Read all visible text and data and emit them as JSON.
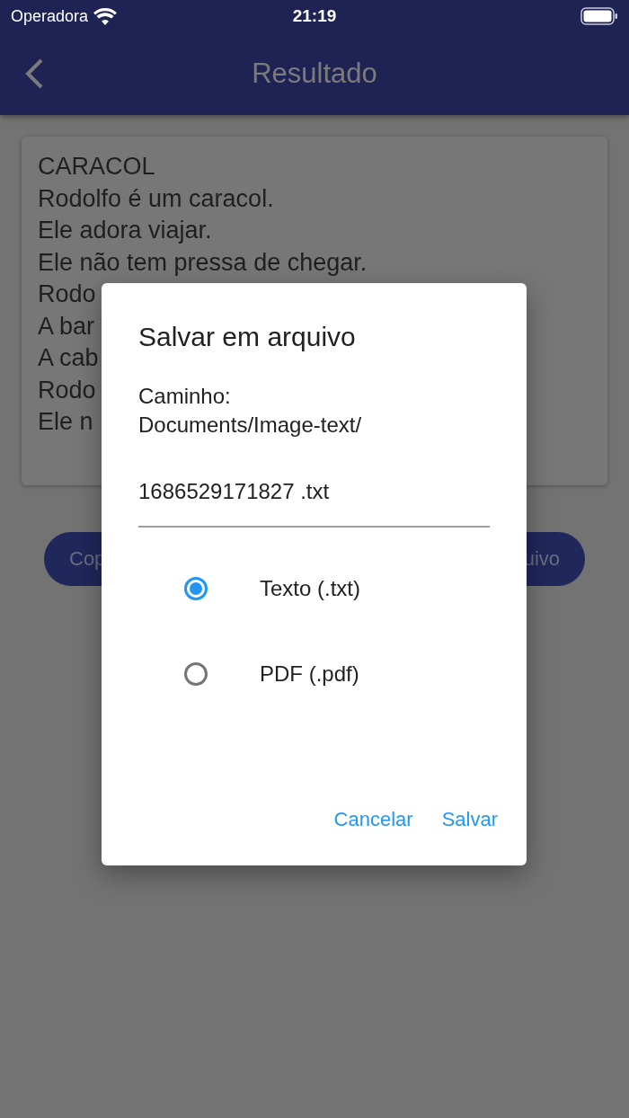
{
  "status_bar": {
    "carrier": "Operadora",
    "time": "21:19"
  },
  "app_bar": {
    "title": "Resultado"
  },
  "text_lines": [
    "CARACOL",
    "Rodolfo é um caracol.",
    "Ele adora viajar.",
    "Ele não tem pressa de chegar.",
    "Rodo",
    "A bar",
    "A cab",
    "Rodo",
    "Ele n"
  ],
  "buttons": [
    "Cop",
    "uivo"
  ],
  "dialog": {
    "title": "Salvar em arquivo",
    "path_label": "Caminho:",
    "path": "Documents/Image-text/",
    "filename": "1686529171827 .txt",
    "options": [
      {
        "label": "Texto (.txt)",
        "selected": true
      },
      {
        "label": "PDF (.pdf)",
        "selected": false
      }
    ],
    "actions": [
      "Cancelar",
      "Salvar"
    ]
  }
}
